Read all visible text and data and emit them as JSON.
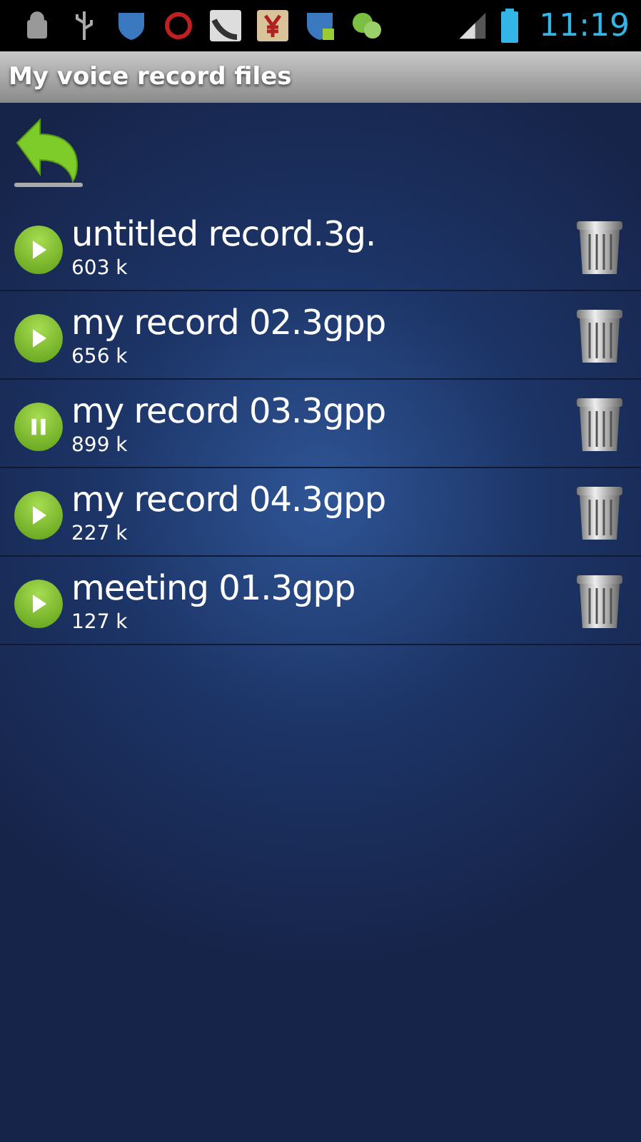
{
  "status_bar": {
    "time": "11:19"
  },
  "title_bar": {
    "title": "My voice record files"
  },
  "records": [
    {
      "name": "untitled record.3g.",
      "size": "603 k",
      "playing": false
    },
    {
      "name": "my record 02.3gpp",
      "size": "656 k",
      "playing": false
    },
    {
      "name": "my record 03.3gpp",
      "size": "899 k",
      "playing": true
    },
    {
      "name": "my record 04.3gpp",
      "size": "227 k",
      "playing": false
    },
    {
      "name": "meeting 01.3gpp",
      "size": "127 k",
      "playing": false
    }
  ]
}
